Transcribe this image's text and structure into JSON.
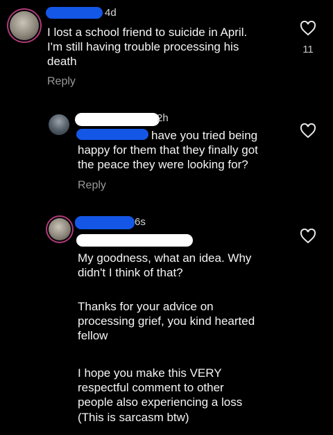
{
  "comments": [
    {
      "time": "4d",
      "lines": [
        "I lost a school friend to suicide in April.",
        "I'm still having trouble processing his",
        "death"
      ],
      "reply": "Reply",
      "likes": "11"
    },
    {
      "time": "2h",
      "first_line_rest": "have you tried being",
      "lines": [
        "happy for them that they finally got",
        "the peace they were looking for?"
      ],
      "reply": "Reply"
    },
    {
      "time": "6s",
      "paragraphs": [
        [
          "My goodness, what an idea. Why",
          "didn't I think of that?"
        ],
        [
          "Thanks for your advice on",
          "processing grief, you kind hearted",
          "fellow"
        ],
        [
          "I hope you make this VERY",
          "respectful comment to other",
          "people also experiencing a loss"
        ],
        [
          "(This is sarcasm btw)"
        ]
      ]
    }
  ],
  "icons": {
    "like": "heart-outline-icon",
    "avatar": "profile-picture"
  },
  "colors": {
    "background": "#000000",
    "redaction": "#1457e6",
    "story_ring": "#b03a7a"
  }
}
